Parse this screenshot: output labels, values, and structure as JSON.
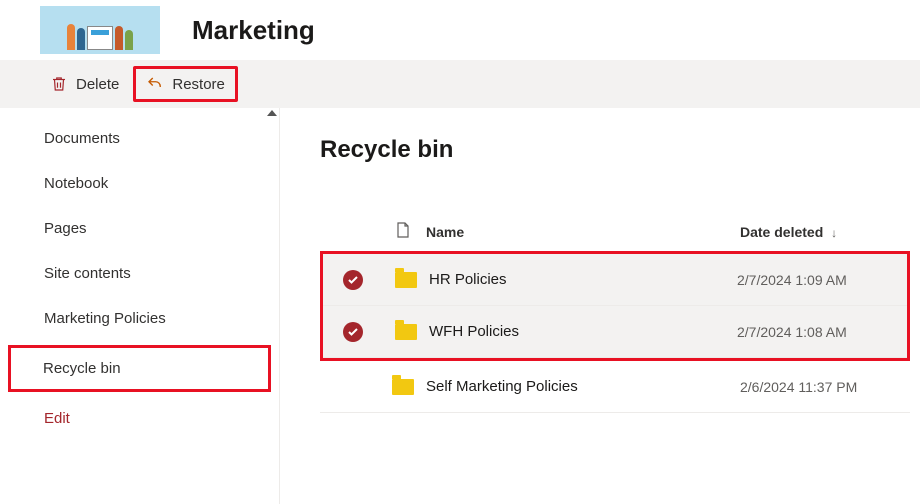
{
  "site": {
    "title": "Marketing"
  },
  "toolbar": {
    "delete_label": "Delete",
    "restore_label": "Restore"
  },
  "sidebar": {
    "items": [
      {
        "label": "Documents"
      },
      {
        "label": "Notebook"
      },
      {
        "label": "Pages"
      },
      {
        "label": "Site contents"
      },
      {
        "label": "Marketing Policies"
      },
      {
        "label": "Recycle bin"
      },
      {
        "label": "Edit"
      }
    ]
  },
  "page": {
    "title": "Recycle bin"
  },
  "table": {
    "columns": {
      "name": "Name",
      "date_deleted": "Date deleted"
    },
    "rows": [
      {
        "name": "HR Policies",
        "date": "2/7/2024 1:09 AM",
        "selected": true
      },
      {
        "name": "WFH Policies",
        "date": "2/7/2024 1:08 AM",
        "selected": true
      },
      {
        "name": "Self Marketing Policies",
        "date": "2/6/2024 11:37 PM",
        "selected": false
      }
    ]
  }
}
